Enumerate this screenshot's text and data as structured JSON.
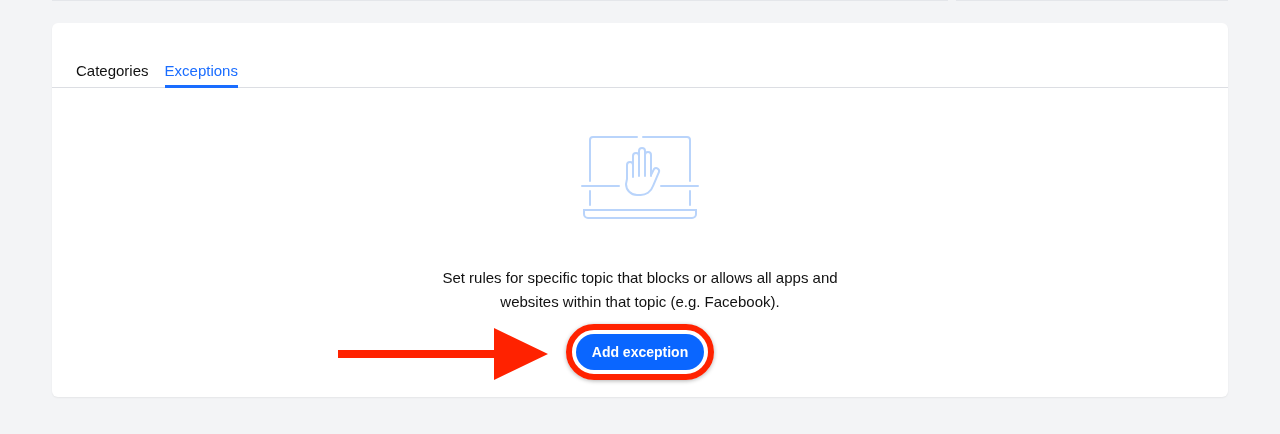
{
  "tabs": [
    {
      "label": "Categories",
      "selected": false
    },
    {
      "label": "Exceptions",
      "selected": true
    }
  ],
  "empty_state": {
    "message": "Set rules for specific topic that blocks or allows all apps and websites within that topic (e.g. Facebook).",
    "button": "Add exception"
  }
}
